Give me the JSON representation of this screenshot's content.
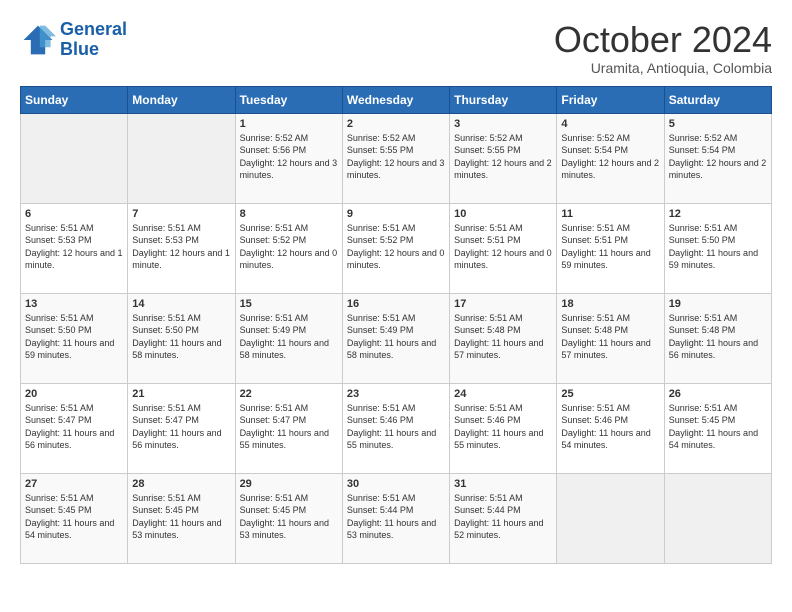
{
  "header": {
    "logo_line1": "General",
    "logo_line2": "Blue",
    "month": "October 2024",
    "location": "Uramita, Antioquia, Colombia"
  },
  "weekdays": [
    "Sunday",
    "Monday",
    "Tuesday",
    "Wednesday",
    "Thursday",
    "Friday",
    "Saturday"
  ],
  "weeks": [
    [
      {
        "day": "",
        "info": ""
      },
      {
        "day": "",
        "info": ""
      },
      {
        "day": "1",
        "info": "Sunrise: 5:52 AM\nSunset: 5:56 PM\nDaylight: 12 hours\nand 3 minutes."
      },
      {
        "day": "2",
        "info": "Sunrise: 5:52 AM\nSunset: 5:55 PM\nDaylight: 12 hours\nand 3 minutes."
      },
      {
        "day": "3",
        "info": "Sunrise: 5:52 AM\nSunset: 5:55 PM\nDaylight: 12 hours\nand 2 minutes."
      },
      {
        "day": "4",
        "info": "Sunrise: 5:52 AM\nSunset: 5:54 PM\nDaylight: 12 hours\nand 2 minutes."
      },
      {
        "day": "5",
        "info": "Sunrise: 5:52 AM\nSunset: 5:54 PM\nDaylight: 12 hours\nand 2 minutes."
      }
    ],
    [
      {
        "day": "6",
        "info": "Sunrise: 5:51 AM\nSunset: 5:53 PM\nDaylight: 12 hours\nand 1 minute."
      },
      {
        "day": "7",
        "info": "Sunrise: 5:51 AM\nSunset: 5:53 PM\nDaylight: 12 hours\nand 1 minute."
      },
      {
        "day": "8",
        "info": "Sunrise: 5:51 AM\nSunset: 5:52 PM\nDaylight: 12 hours\nand 0 minutes."
      },
      {
        "day": "9",
        "info": "Sunrise: 5:51 AM\nSunset: 5:52 PM\nDaylight: 12 hours\nand 0 minutes."
      },
      {
        "day": "10",
        "info": "Sunrise: 5:51 AM\nSunset: 5:51 PM\nDaylight: 12 hours\nand 0 minutes."
      },
      {
        "day": "11",
        "info": "Sunrise: 5:51 AM\nSunset: 5:51 PM\nDaylight: 11 hours\nand 59 minutes."
      },
      {
        "day": "12",
        "info": "Sunrise: 5:51 AM\nSunset: 5:50 PM\nDaylight: 11 hours\nand 59 minutes."
      }
    ],
    [
      {
        "day": "13",
        "info": "Sunrise: 5:51 AM\nSunset: 5:50 PM\nDaylight: 11 hours\nand 59 minutes."
      },
      {
        "day": "14",
        "info": "Sunrise: 5:51 AM\nSunset: 5:50 PM\nDaylight: 11 hours\nand 58 minutes."
      },
      {
        "day": "15",
        "info": "Sunrise: 5:51 AM\nSunset: 5:49 PM\nDaylight: 11 hours\nand 58 minutes."
      },
      {
        "day": "16",
        "info": "Sunrise: 5:51 AM\nSunset: 5:49 PM\nDaylight: 11 hours\nand 58 minutes."
      },
      {
        "day": "17",
        "info": "Sunrise: 5:51 AM\nSunset: 5:48 PM\nDaylight: 11 hours\nand 57 minutes."
      },
      {
        "day": "18",
        "info": "Sunrise: 5:51 AM\nSunset: 5:48 PM\nDaylight: 11 hours\nand 57 minutes."
      },
      {
        "day": "19",
        "info": "Sunrise: 5:51 AM\nSunset: 5:48 PM\nDaylight: 11 hours\nand 56 minutes."
      }
    ],
    [
      {
        "day": "20",
        "info": "Sunrise: 5:51 AM\nSunset: 5:47 PM\nDaylight: 11 hours\nand 56 minutes."
      },
      {
        "day": "21",
        "info": "Sunrise: 5:51 AM\nSunset: 5:47 PM\nDaylight: 11 hours\nand 56 minutes."
      },
      {
        "day": "22",
        "info": "Sunrise: 5:51 AM\nSunset: 5:47 PM\nDaylight: 11 hours\nand 55 minutes."
      },
      {
        "day": "23",
        "info": "Sunrise: 5:51 AM\nSunset: 5:46 PM\nDaylight: 11 hours\nand 55 minutes."
      },
      {
        "day": "24",
        "info": "Sunrise: 5:51 AM\nSunset: 5:46 PM\nDaylight: 11 hours\nand 55 minutes."
      },
      {
        "day": "25",
        "info": "Sunrise: 5:51 AM\nSunset: 5:46 PM\nDaylight: 11 hours\nand 54 minutes."
      },
      {
        "day": "26",
        "info": "Sunrise: 5:51 AM\nSunset: 5:45 PM\nDaylight: 11 hours\nand 54 minutes."
      }
    ],
    [
      {
        "day": "27",
        "info": "Sunrise: 5:51 AM\nSunset: 5:45 PM\nDaylight: 11 hours\nand 54 minutes."
      },
      {
        "day": "28",
        "info": "Sunrise: 5:51 AM\nSunset: 5:45 PM\nDaylight: 11 hours\nand 53 minutes."
      },
      {
        "day": "29",
        "info": "Sunrise: 5:51 AM\nSunset: 5:45 PM\nDaylight: 11 hours\nand 53 minutes."
      },
      {
        "day": "30",
        "info": "Sunrise: 5:51 AM\nSunset: 5:44 PM\nDaylight: 11 hours\nand 53 minutes."
      },
      {
        "day": "31",
        "info": "Sunrise: 5:51 AM\nSunset: 5:44 PM\nDaylight: 11 hours\nand 52 minutes."
      },
      {
        "day": "",
        "info": ""
      },
      {
        "day": "",
        "info": ""
      }
    ]
  ]
}
